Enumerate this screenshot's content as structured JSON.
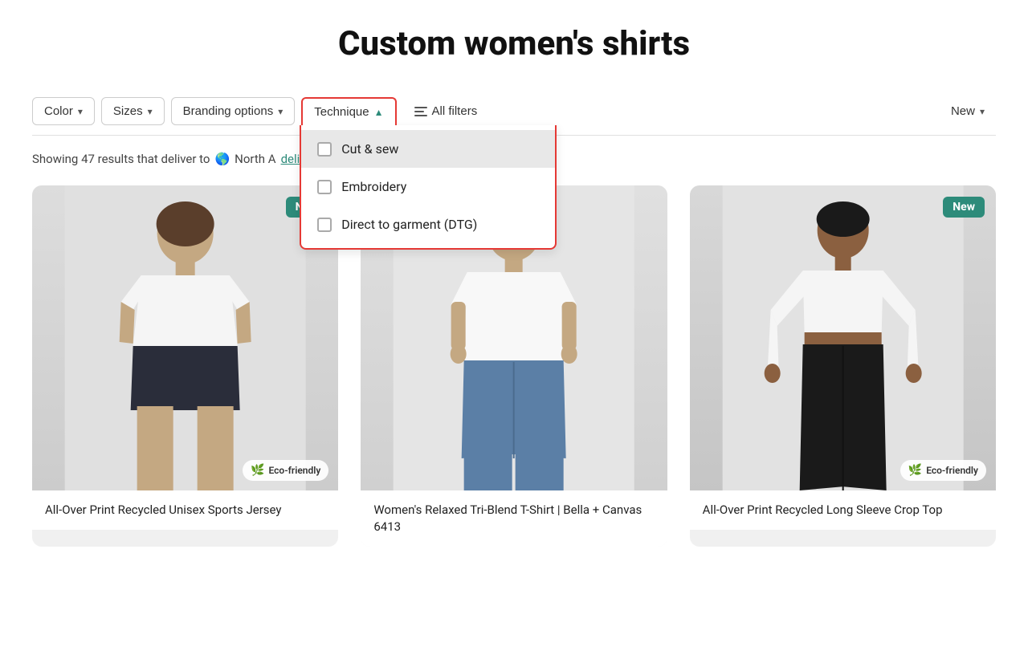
{
  "page": {
    "title": "Custom women's shirts"
  },
  "filters": {
    "color_label": "Color",
    "sizes_label": "Sizes",
    "branding_label": "Branding options",
    "technique_label": "Technique",
    "all_filters_label": "All filters",
    "new_label": "New"
  },
  "technique_dropdown": {
    "items": [
      {
        "id": "cut-sew",
        "label": "Cut & sew",
        "checked": false,
        "highlighted": true
      },
      {
        "id": "embroidery",
        "label": "Embroidery",
        "checked": false,
        "highlighted": false
      },
      {
        "id": "dtg",
        "label": "Direct to garment (DTG)",
        "checked": false,
        "highlighted": false
      }
    ]
  },
  "results": {
    "text": "Showing 47 results that deliver to",
    "region": "North A",
    "delivery_pref": "delivery preferences",
    "info_tooltip": "i"
  },
  "products": [
    {
      "id": 1,
      "name": "All-Over Print Recycled Unisex Sports Jersey",
      "badge": "New",
      "eco": true,
      "eco_label": "Eco-friendly",
      "bg": "#e5e5e5"
    },
    {
      "id": 2,
      "name": "Women's Relaxed Tri-Blend T-Shirt | Bella + Canvas 6413",
      "badge": null,
      "eco": false,
      "bg": "#e8e8e8"
    },
    {
      "id": 3,
      "name": "All-Over Print Recycled Long Sleeve Crop Top",
      "badge": "New",
      "eco": true,
      "eco_label": "Eco-friendly",
      "bg": "#e5e5e5"
    }
  ],
  "icons": {
    "globe": "🌎",
    "leaf": "🌿",
    "chevron_down": "∨",
    "chevron_up": "∧",
    "info": "i"
  }
}
